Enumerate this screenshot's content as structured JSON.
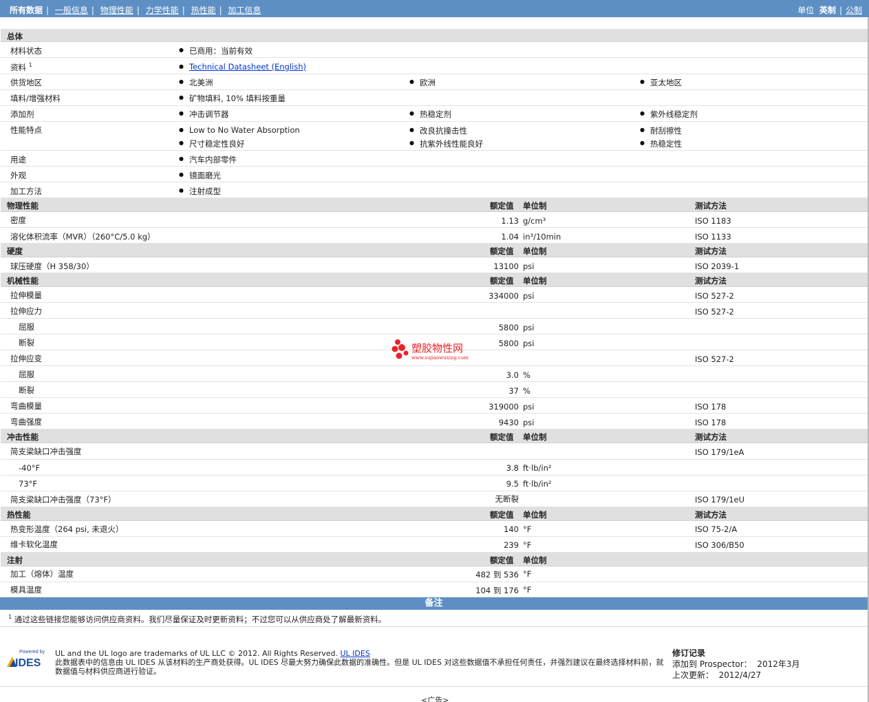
{
  "nav": {
    "all": "所有数据",
    "tabs": [
      "一般信息",
      "物理性能",
      "力学性能",
      "热性能",
      "加工信息"
    ],
    "unit_label": "单位",
    "imperial": "英制",
    "metric": "公制"
  },
  "general": {
    "title": "总体",
    "status_label": "材料状态",
    "status_value": "已商用：当前有效",
    "source_label": "资料",
    "source_sup": "1",
    "source_link": "Technical Datasheet (English)",
    "region_label": "供货地区",
    "regions": [
      "北美洲",
      "欧洲",
      "亚太地区"
    ],
    "filler_label": "填料/增强材料",
    "filler_value": "矿物填料, 10% 填料按重量",
    "additive_label": "添加剂",
    "additives": [
      "冲击调节器",
      "热稳定剂",
      "紫外线稳定剂"
    ],
    "features_label": "性能特点",
    "features": [
      "Low to No Water Absorption",
      "改良抗撞击性",
      "耐刮擦性",
      "尺寸稳定性良好",
      "抗紫外线性能良好",
      "热稳定性"
    ],
    "use_label": "用途",
    "use_value": "汽车内部零件",
    "appearance_label": "外观",
    "appearance_value": "镜面磨光",
    "process_label": "加工方法",
    "process_value": "注射成型"
  },
  "headers": {
    "nominal": "额定值",
    "unit": "单位制",
    "method": "测试方法"
  },
  "physical": {
    "title": "物理性能",
    "rows": [
      {
        "label": "密度",
        "value": "1.13",
        "unit": "g/cm³",
        "method": "ISO 1183"
      },
      {
        "label": "溶化体积流率（MVR）（260°C/5.0 kg）",
        "value": "1.04",
        "unit": "in³/10min",
        "method": "ISO 1133"
      }
    ]
  },
  "hardness": {
    "title": "硬度",
    "rows": [
      {
        "label": "球压硬度（H 358/30）",
        "value": "13100",
        "unit": "psi",
        "method": "ISO 2039-1"
      }
    ]
  },
  "mechanical": {
    "title": "机械性能",
    "rows": [
      {
        "label": "拉伸模量",
        "value": "334000",
        "unit": "psi",
        "method": "ISO 527-2"
      },
      {
        "label": "拉伸应力",
        "value": "",
        "unit": "",
        "method": "ISO 527-2"
      },
      {
        "label": "屈服",
        "value": "5800",
        "unit": "psi",
        "method": ""
      },
      {
        "label": "断裂",
        "value": "5800",
        "unit": "psi",
        "method": ""
      },
      {
        "label": "拉伸应变",
        "value": "",
        "unit": "",
        "method": "ISO 527-2"
      },
      {
        "label": "屈服",
        "value": "3.0",
        "unit": "%",
        "method": ""
      },
      {
        "label": "断裂",
        "value": "37",
        "unit": "%",
        "method": ""
      },
      {
        "label": "弯曲模量",
        "value": "319000",
        "unit": "psi",
        "method": "ISO 178"
      },
      {
        "label": "弯曲强度",
        "value": "9430",
        "unit": "psi",
        "method": "ISO 178"
      }
    ]
  },
  "impact": {
    "title": "冲击性能",
    "rows": [
      {
        "label": "简支梁缺口冲击强度",
        "value": "",
        "unit": "",
        "method": "ISO 179/1eA"
      },
      {
        "label": "-40°F",
        "value": "3.8",
        "unit": "ft·lb/in²",
        "method": ""
      },
      {
        "label": "73°F",
        "value": "9.5",
        "unit": "ft·lb/in²",
        "method": ""
      },
      {
        "label": "简支梁缺口冲击强度（73°F）",
        "value": "无断裂",
        "unit": "",
        "method": "ISO 179/1eU"
      }
    ]
  },
  "thermal": {
    "title": "热性能",
    "rows": [
      {
        "label": "热变形温度（264 psi, 未退火）",
        "value": "140",
        "unit": "°F",
        "method": "ISO 75-2/A"
      },
      {
        "label": "维卡软化温度",
        "value": "239",
        "unit": "°F",
        "method": "ISO 306/B50"
      }
    ]
  },
  "injection": {
    "title": "注射",
    "rows": [
      {
        "label": "加工（熔体）温度",
        "value": "482 到  536",
        "unit": "°F"
      },
      {
        "label": "模具温度",
        "value": "104 到  176",
        "unit": "°F"
      }
    ]
  },
  "notes": {
    "title": "备注",
    "sup": "1",
    "text": "通过这些链接您能够访问供应商资料。我们尽量保证及时更新资料；不过您可以从供应商处了解最新资料。"
  },
  "footer": {
    "powered": "Powered by",
    "logo": "IDES",
    "line1": "UL and the UL logo are trademarks of UL LLC © 2012. All Rights Reserved.",
    "ul_link": "UL IDES",
    "line2": "此数据表中的信息由  UL IDES 从该材料的生产商处获得。UL IDES 尽最大努力确保此数据的准确性。但是  UL IDES 对这些数据值不承担任何责任，并强烈建议在最终选择材料前，就数据值与材料供应商进行验证。",
    "rev_title": "修订记录",
    "added_label": "添加到  Prospector：",
    "added_value": "2012年3月",
    "updated_label": "上次更新：",
    "updated_value": "2012/4/27"
  },
  "watermark": {
    "title": "塑胶物性网",
    "url": "www.sujiaowuxing.com"
  },
  "ad": "<广告>",
  "colors": {
    "topbar": "#5d8fc4",
    "header_row": "#e0e0e0",
    "link": "#0033cc",
    "watermark": "#e8232a"
  }
}
